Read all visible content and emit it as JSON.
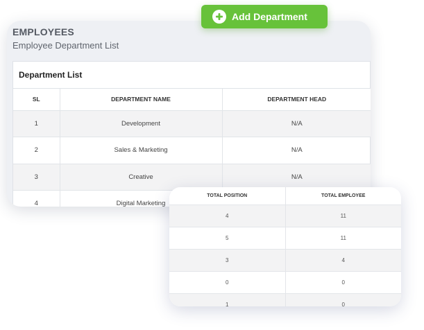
{
  "header": {
    "title": "EMPLOYEES",
    "subtitle": "Employee Department List"
  },
  "add_button": {
    "label": "Add Department",
    "icon": "plus-circle-icon",
    "color": "#67c23a"
  },
  "department_list": {
    "title": "Department List",
    "columns": [
      "SL",
      "DEPARTMENT NAME",
      "DEPARTMENT HEAD"
    ],
    "rows": [
      [
        "1",
        "Development",
        "N/A"
      ],
      [
        "2",
        "Sales & Marketing",
        "N/A"
      ],
      [
        "3",
        "Creative",
        "N/A"
      ],
      [
        "4",
        "Digital Marketing",
        ""
      ]
    ]
  },
  "totals": {
    "columns": [
      "TOTAL POSITION",
      "TOTAL EMPLOYEE"
    ],
    "rows": [
      [
        "4",
        "11"
      ],
      [
        "5",
        "11"
      ],
      [
        "3",
        "4"
      ],
      [
        "0",
        "0"
      ],
      [
        "1",
        "0"
      ]
    ]
  }
}
